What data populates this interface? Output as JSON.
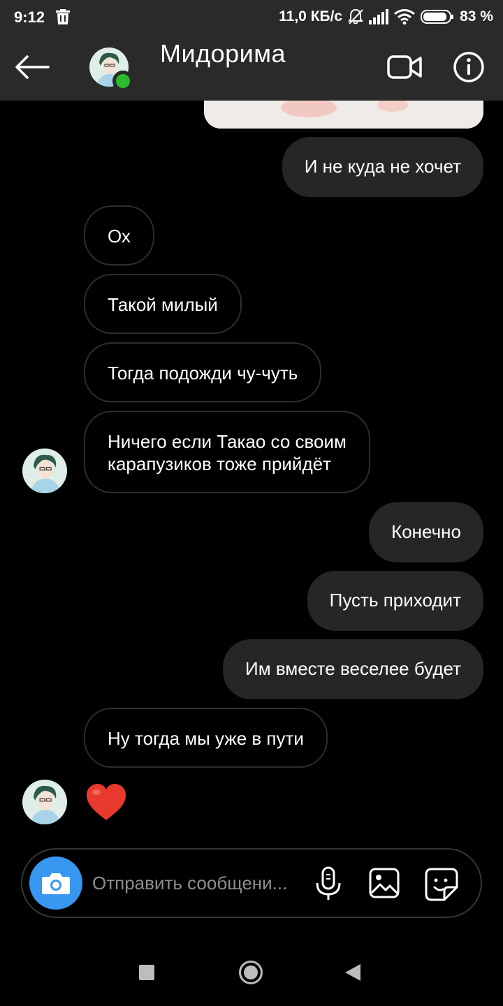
{
  "status_bar": {
    "time": "9:12",
    "network_speed": "11,0 КБ/с",
    "battery": "83 %"
  },
  "header": {
    "contact_name": "Мидорима",
    "online": true
  },
  "messages": [
    {
      "direction": "outgoing",
      "text": "И не куда не хочет"
    },
    {
      "direction": "incoming",
      "text": "Ох"
    },
    {
      "direction": "incoming",
      "text": "Такой милый"
    },
    {
      "direction": "incoming",
      "text": "Тогда подожди чу-чуть"
    },
    {
      "direction": "incoming",
      "text_line1": "Ничего если Такао со своим",
      "text_line2": "карапузиков тоже прийдёт"
    },
    {
      "direction": "outgoing",
      "text": "Конечно"
    },
    {
      "direction": "outgoing",
      "text": "Пусть приходит"
    },
    {
      "direction": "outgoing",
      "text": "Им вместе веселее будет"
    },
    {
      "direction": "incoming",
      "text": "Ну тогда мы уже в пути"
    },
    {
      "direction": "incoming",
      "reaction": "heart"
    }
  ],
  "composer": {
    "placeholder": "Отправить сообщени..."
  },
  "colors": {
    "accent_blue": "#3897f0",
    "online_green": "#2dbb2d",
    "heart_red": "#e8392d",
    "bubble_outgoing": "#262626"
  }
}
